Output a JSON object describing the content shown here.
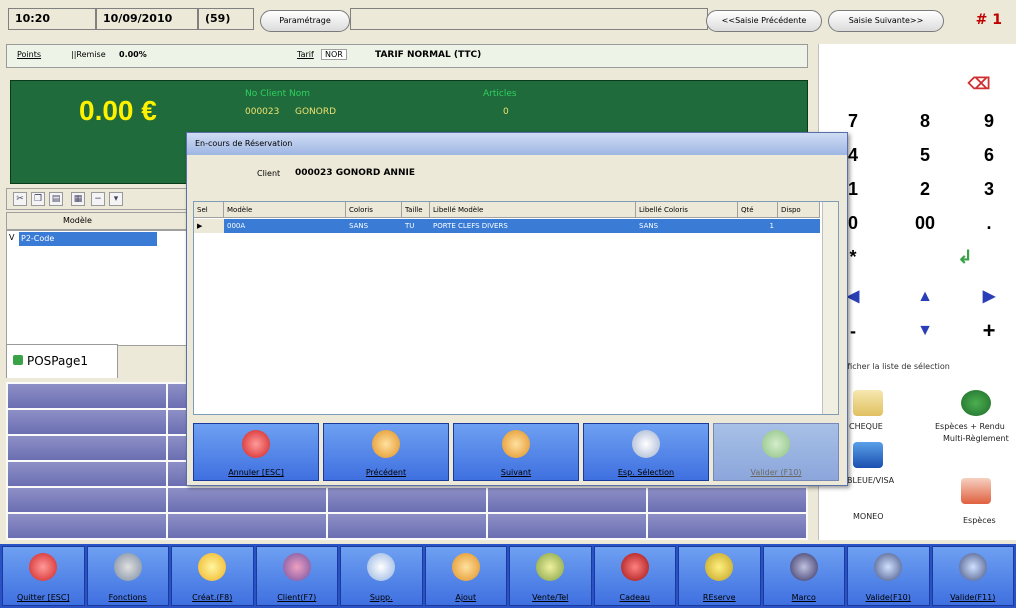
{
  "header": {
    "time": "10:20",
    "date": "10/09/2010",
    "count": "(59)",
    "settings_label": "Paramétrage",
    "prev_label": "<<Saisie Précédente",
    "next_label": "Saisie Suivante>>",
    "page_num": "# 1"
  },
  "info": {
    "points_label": "Points",
    "remise_label": "||Remise",
    "remise_value": "0.00%",
    "tarif_label": "Tarif",
    "tarif_code": "NOR",
    "tarif_name": "TARIF NORMAL (TTC)"
  },
  "display": {
    "total": "0.00 €",
    "client_label": "No Client  Nom",
    "client_no": "000023",
    "client_name": "GONORD",
    "articles_label": "Articles",
    "articles_value": "0"
  },
  "grid": {
    "column": "Modèle",
    "row_indicator": "V",
    "row_value": "P2-Code"
  },
  "pos_tab": "POSPage1",
  "keypad": {
    "keys": [
      "7",
      "8",
      "9",
      "4",
      "5",
      "6",
      "1",
      "2",
      "3",
      "0",
      "00",
      "."
    ],
    "star": "*",
    "minus": "-",
    "plus": "+",
    "selection_label": "Afficher la liste de sélection",
    "payments": {
      "cheque": "CHEQUE",
      "especes_rendu": "Espèces + Rendu",
      "multi": "Multi-Règlement",
      "bleue_visa": "BLEUE/VISA",
      "moneo": "MONEO",
      "especes": "Espèces"
    }
  },
  "dialog": {
    "title": "En-cours de Réservation",
    "client_label": "Client",
    "client_value": "000023 GONORD ANNIE",
    "columns": [
      "Sel",
      "Modèle",
      "Coloris",
      "Taille",
      "Libellé Modèle",
      "Libellé Coloris",
      "Qté",
      "Dispo"
    ],
    "rows": [
      {
        "sel": "",
        "modele": "000A",
        "coloris": "SANS",
        "taille": "TU",
        "lib_modele": "PORTE CLEFS DIVERS",
        "lib_coloris": "SANS",
        "qte": "1",
        "dispo": ""
      }
    ],
    "buttons": [
      "Annuler [ESC]",
      "Précédent",
      "Suivant",
      "Esp. Sélection",
      "Valider (F10)"
    ]
  },
  "bottom_bar": {
    "buttons": [
      "Quitter [ESC]",
      "Fonctions",
      "Créat.(F8)",
      "Client(F7)",
      "Supp.",
      "Ajout",
      "Vente/Tel",
      "Cadeau",
      "REserve",
      "Marco",
      "Valide(F10)",
      "Valide(F11)"
    ]
  },
  "colors": {
    "display_green": "#1f6b3b",
    "total_yellow": "#fff200",
    "button_blue": "#3f70e0",
    "selection_blue": "#3a7bd5",
    "pos_purple": "#7a7ebc"
  }
}
